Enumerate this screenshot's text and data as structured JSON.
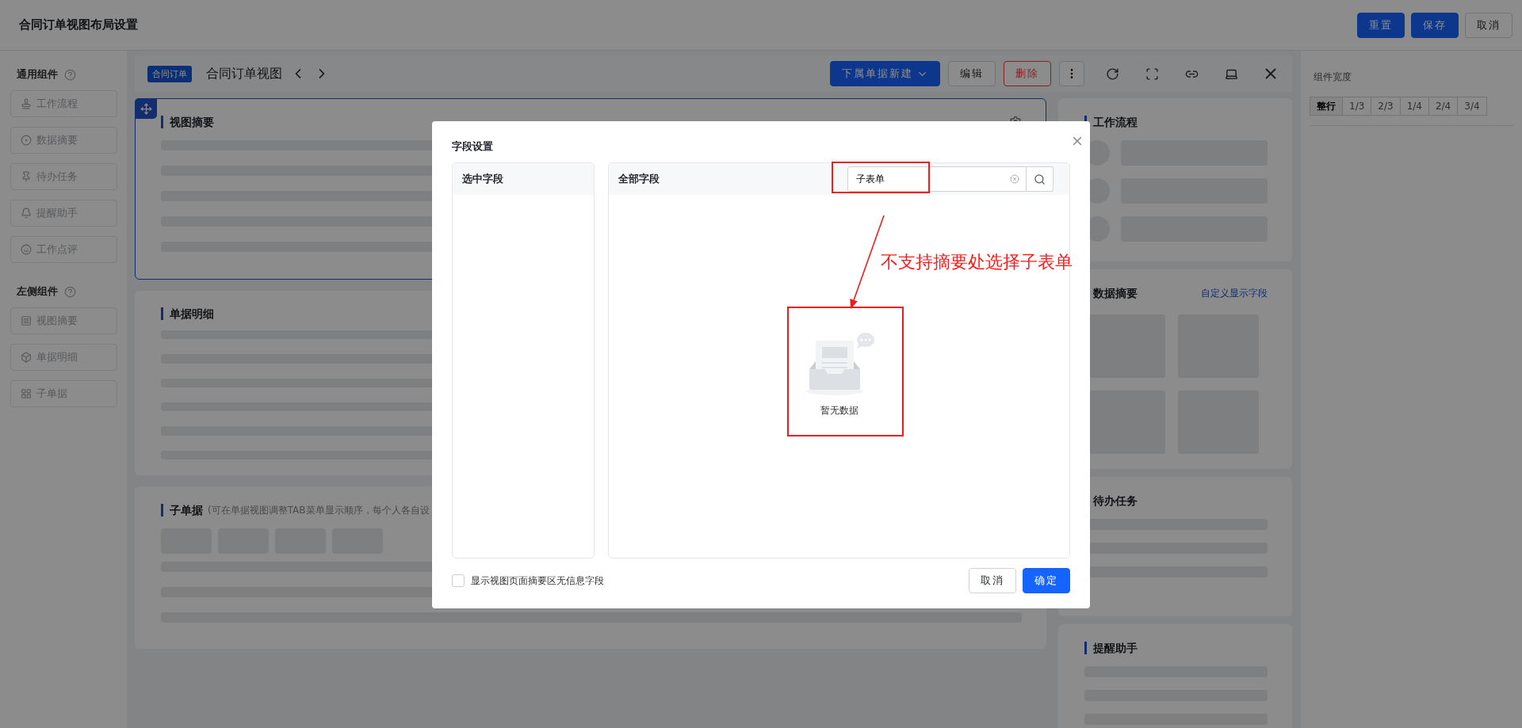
{
  "header": {
    "title": "合同订单视图布局设置",
    "buttons": [
      {
        "label": "重置",
        "kind": "primary"
      },
      {
        "label": "保存",
        "kind": "primary"
      },
      {
        "label": "取消",
        "kind": "default"
      }
    ]
  },
  "sidebar": {
    "sections": [
      {
        "title": "通用组件",
        "items": [
          {
            "label": "工作流程"
          },
          {
            "label": "数据摘要"
          },
          {
            "label": "待办任务"
          },
          {
            "label": "提醒助手"
          },
          {
            "label": "工作点评"
          }
        ]
      },
      {
        "title": "左侧组件",
        "items": [
          {
            "label": "视图摘要"
          },
          {
            "label": "单据明细"
          },
          {
            "label": "子单据"
          }
        ]
      }
    ]
  },
  "toolbar": {
    "badge": "合同订单",
    "title": "合同订单视图",
    "actions": [
      {
        "label": "下属单据新建",
        "kind": "dropdown"
      },
      {
        "label": "编辑",
        "kind": "default"
      },
      {
        "label": "删除",
        "kind": "danger"
      }
    ]
  },
  "main_cards": [
    {
      "kind": "summary",
      "title": "视图摘要",
      "selected": true
    },
    {
      "kind": "detail",
      "title": "单据明细",
      "selected": false
    },
    {
      "kind": "sub",
      "title": "子单据",
      "note": "(可在单据视图调整TAB菜单显示顺序，每个人各自设",
      "selected": false
    }
  ],
  "side_cards": [
    {
      "kind": "workflow",
      "title": "工作流程"
    },
    {
      "kind": "summary",
      "title": "数据摘要",
      "link": "自定义显示字段"
    },
    {
      "kind": "list",
      "title": "待办任务"
    },
    {
      "kind": "list",
      "title": "提醒助手"
    }
  ],
  "width_panel": {
    "title": "组件宽度",
    "options": [
      {
        "label": "整行",
        "selected": true
      },
      {
        "label": "1/3",
        "selected": false
      },
      {
        "label": "2/3",
        "selected": false
      },
      {
        "label": "1/4",
        "selected": false
      },
      {
        "label": "2/4",
        "selected": false
      },
      {
        "label": "3/4",
        "selected": false
      }
    ]
  },
  "dialog": {
    "title": "字段设置",
    "selected_panel": {
      "title": "选中字段"
    },
    "all_panel": {
      "title": "全部字段",
      "search": {
        "value": "子表单"
      },
      "empty_text": "暂无数据"
    },
    "checkbox": {
      "label": "显示视图页面摘要区无信息字段",
      "checked": false
    },
    "buttons": [
      {
        "label": "取消",
        "kind": "default"
      },
      {
        "label": "确定",
        "kind": "primary"
      }
    ]
  },
  "annotation": {
    "text": "不支持摘要处选择子表单"
  }
}
